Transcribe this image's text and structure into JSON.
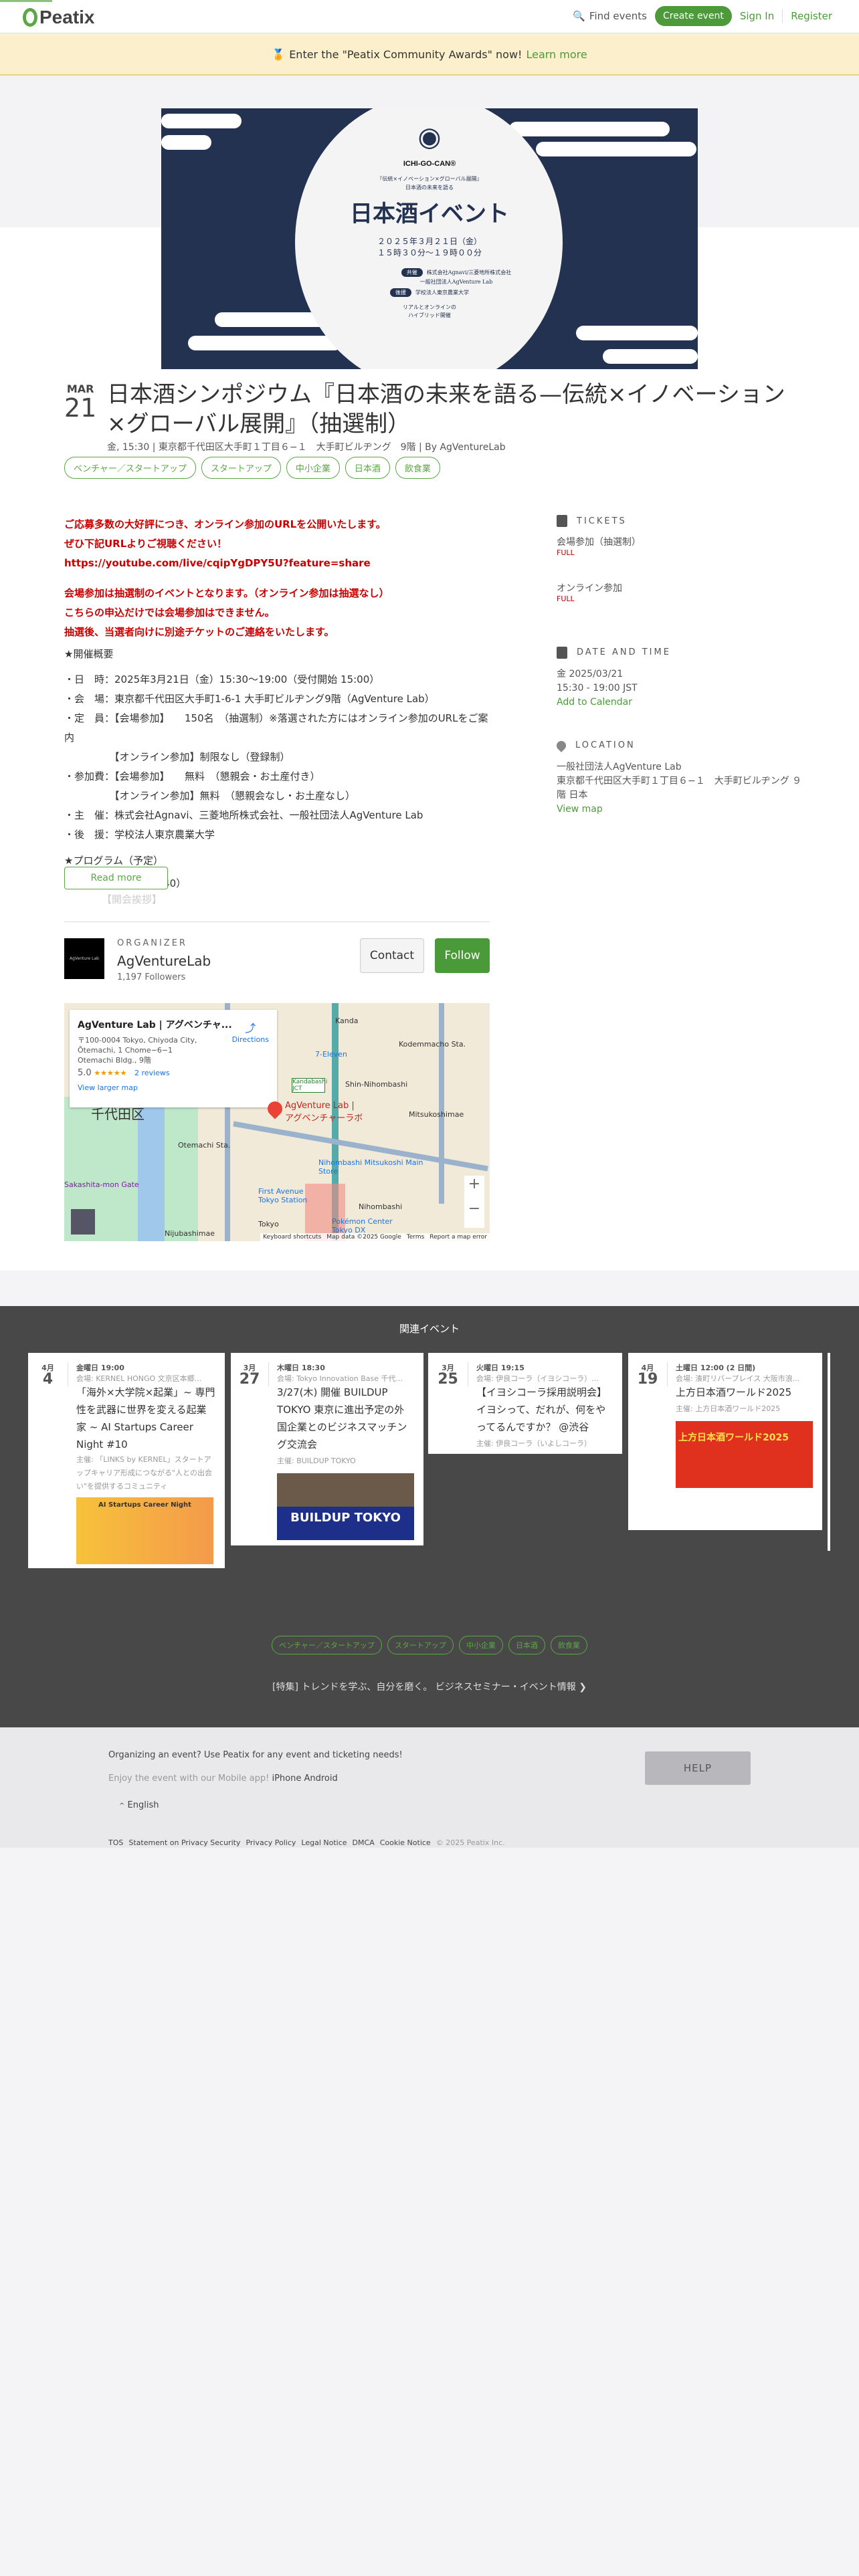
{
  "header": {
    "logo": "Peatix",
    "find_events": "Find events",
    "create_event": "Create event",
    "sign_in": "Sign In",
    "register": "Register"
  },
  "announcement": {
    "text": "Enter the \"Peatix Community Awards\" now!",
    "link": "Learn more"
  },
  "poster": {
    "brand": "ICHI-GO-CAN®",
    "subtitle1": "『伝統×イノベーション×グローバル展開』",
    "subtitle2": "日本酒の未来を語る",
    "headline": "日本酒イベント",
    "date": "２０２５年３月２１日（金）",
    "time": "１５時３０分〜１９時００分",
    "cohost_label": "共催",
    "cohost1": "株式会社Agnavi/三菱地所株式会社",
    "cohost2": "一般社団法人AgVenture Lab",
    "support_label": "後援",
    "support": "学校法人東京農業大学",
    "format1": "リアルとオンラインの",
    "format2": "ハイブリッド開催"
  },
  "event": {
    "month": "MAR",
    "day": "21",
    "title": "日本酒シンポジウム『日本酒の未来を語る—伝統×イノベーション×グローバル展開』（抽選制）",
    "meta": "金, 15:30 | 東京都千代田区大手町１丁目６−１　大手町ビルヂング　9階 | By AgVentureLab",
    "tags": [
      "ベンチャー／スタートアップ",
      "スタートアップ",
      "中小企業",
      "日本酒",
      "飲食業"
    ]
  },
  "description": {
    "red1": [
      "ご応募多数の大好評につき、オンライン参加のURLを公開いたします。",
      "ぜひ下記URLよりご視聴ください！",
      "https://youtube.com/live/cqipYgDPY5U?feature=share"
    ],
    "red2": [
      "会場参加は抽選制のイベントとなります。（オンライン参加は抽選なし）",
      "こちらの申込だけでは会場参加はできません。",
      "抽選後、当選者向けに別途チケットのご連絡をいたします。"
    ],
    "overview_heading": "★開催概要",
    "overview": [
      "・日　時：2025年3月21日（金）15:30〜19:00（受付開始 15:00）",
      "・会　場：東京都千代田区大手町1-6-1 大手町ビルヂング9階（AgVenture Lab）",
      "・定　員：【会場参加】　　150名　（抽選制）※落選された方にはオンライン参加のURLをご案内",
      "　　　　　【オンライン参加】制限なし（登録制）",
      "・参加費：【会場参加】　　無料　（懇親会・お土産付き）",
      "　　　　　【オンライン参加】無料　（懇親会なし・お土産なし）",
      "・主　催：株式会社Agnavi、三菱地所株式会社、一般社団法人AgVenture Lab",
      "・後　援：学校法人東京農業大学"
    ],
    "program_heading": "★プログラム（予定）",
    "program1": "開 会（15:30〜15:40）",
    "program2": "【開会挨拶】",
    "read_more": "Read more"
  },
  "organizer": {
    "label": "ORGANIZER",
    "name": "AgVentureLab",
    "followers": "1,197 Followers",
    "contact": "Contact",
    "follow": "Follow",
    "logo_text": "AgVenture Lab"
  },
  "map": {
    "place": "AgVenture Lab | アグベンチャ...",
    "address": "〒100-0004 Tokyo, Chiyoda City, Ōtemachi, 1 Chome−6−1 Otemachi Bldg., 9階",
    "rating": "5.0",
    "stars": "★★★★★",
    "reviews": "2 reviews",
    "directions": "Directions",
    "larger": "View larger map",
    "pin_label": "AgVenture Lab | アグベンチャーラボ",
    "labels": [
      "Kanda",
      "Kodemmacho Sta.",
      "7-Eleven",
      "Shin-Nihombashi",
      "Kandabashi JCT",
      "Mitsukoshimae",
      "Otemachi Sta.",
      "千代田区",
      "Nihombashi Mitsukoshi Main Store",
      "First Avenue Tokyo Station",
      "Nihombashi",
      "Pokémon Center Tokyo DX",
      "Tokyo",
      "Nijubashimae",
      "Sakashita-mon Gate"
    ],
    "footer": [
      "Keyboard shortcuts",
      "Map data ©2025 Google",
      "Terms",
      "Report a map error"
    ]
  },
  "sidebar": {
    "tickets_heading": "TICKETS",
    "tickets": [
      {
        "name": "会場参加（抽選制）",
        "status": "FULL"
      },
      {
        "name": "オンライン参加",
        "status": "FULL"
      }
    ],
    "date_heading": "DATE AND TIME",
    "date": "金 2025/03/21",
    "time": "15:30 - 19:00 JST",
    "add_calendar": "Add to Calendar",
    "location_heading": "LOCATION",
    "venue": "一般社団法人AgVenture Lab",
    "address": "東京都千代田区大手町１丁目６−１　大手町ビルヂング ９階 日本",
    "view_map": "View map"
  },
  "related": {
    "heading": "関連イベント",
    "cards": [
      {
        "month": "4月",
        "day": "4",
        "when": "金曜日 19:00",
        "venue": "会場: KERNEL HONGO 文京区本郷...",
        "title": "「海外×大学院×起業」~ 専門性を武器に世界を変える起業家 ~ AI Startups Career Night #10",
        "host": "主催: 「LINKS by KERNEL」スタートアップキャリア形成につながる\"人との出会い\"を提供するコミュニティ",
        "thumb": "AI Startups Career Night"
      },
      {
        "month": "3月",
        "day": "27",
        "when": "木曜日 18:30",
        "venue": "会場: Tokyo Innovation Base 千代...",
        "title": "3/27(木) 開催 BUILDUP TOKYO 東京に進出予定の外国企業とのビジネスマッチング交流会",
        "host": "主催: BUILDUP TOKYO",
        "thumb": "BUILDUP TOKYO"
      },
      {
        "month": "3月",
        "day": "25",
        "when": "火曜日 19:15",
        "venue": "会場: 伊良コーラ（イヨシコーラ）...",
        "title": "【イヨシコーラ採用説明会】イヨシって、だれが、何をやってるんですか？ @渋谷",
        "host": "主催: 伊良コーラ（いよしコーラ）"
      },
      {
        "month": "4月",
        "day": "19",
        "when": "土曜日 12:00 (2 日間)",
        "venue": "会場: 湊町リバープレイス 大阪市浪...",
        "title": "上方日本酒ワールド2025",
        "host": "主催: 上方日本酒ワールド2025",
        "thumb": "上方日本酒ワールド2025"
      }
    ],
    "tags": [
      "ベンチャー／スタートアップ",
      "スタートアップ",
      "中小企業",
      "日本酒",
      "飲食業"
    ],
    "feature": "[特集] トレンドを学ぶ、自分を磨く。 ビジネスセミナー・イベント情報"
  },
  "footer": {
    "organizing": "Organizing an event? Use Peatix for any event and ticketing needs!",
    "app": "Enjoy the event with our Mobile app!",
    "iphone": "iPhone",
    "android": "Android",
    "help": "HELP",
    "language": "English",
    "links": [
      "TOS",
      "Statement on Privacy Security",
      "Privacy Policy",
      "Legal Notice",
      "DMCA",
      "Cookie Notice"
    ],
    "copyright": "© 2025 Peatix Inc."
  }
}
